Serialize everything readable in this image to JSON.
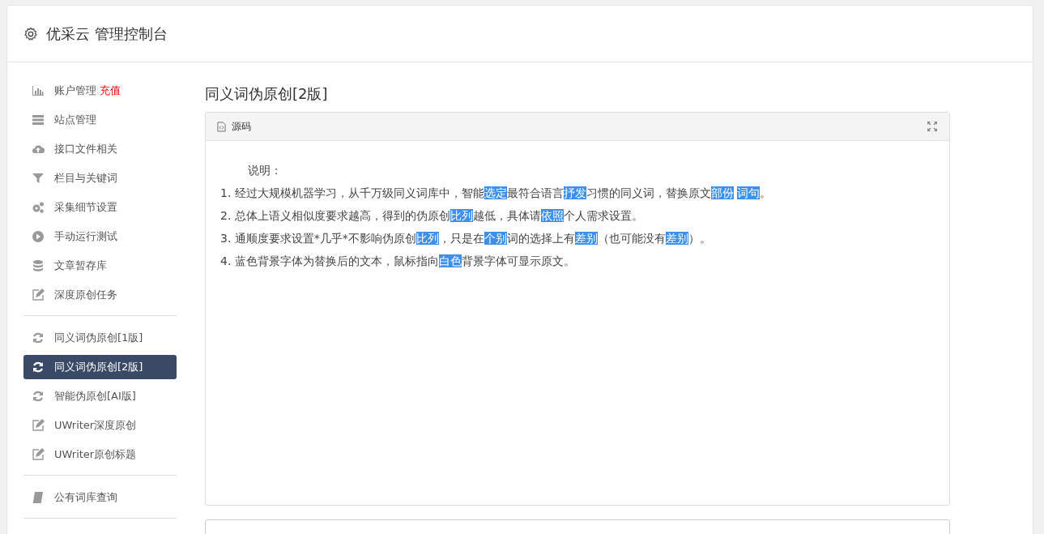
{
  "header": {
    "title": "优采云 管理控制台"
  },
  "sidebar": {
    "groups": [
      {
        "items": [
          {
            "label": "账户管理",
            "badge": "充值",
            "selected": false
          },
          {
            "label": "站点管理",
            "selected": false
          },
          {
            "label": "接口文件相关",
            "selected": false
          },
          {
            "label": "栏目与关键词",
            "selected": false
          },
          {
            "label": "采集细节设置",
            "selected": false
          },
          {
            "label": "手动运行测试",
            "selected": false
          },
          {
            "label": "文章暂存库",
            "selected": false
          },
          {
            "label": "深度原创任务",
            "selected": false
          }
        ]
      },
      {
        "items": [
          {
            "label": "同义词伪原创[1版]",
            "selected": false
          },
          {
            "label": "同义词伪原创[2版]",
            "selected": true
          },
          {
            "label": "智能伪原创[AI版]",
            "selected": false
          },
          {
            "label": "UWriter深度原创",
            "selected": false
          },
          {
            "label": "UWriter原创标题",
            "selected": false
          }
        ]
      },
      {
        "items": [
          {
            "label": "公有词库查询",
            "selected": false
          }
        ]
      }
    ]
  },
  "page_title": "同义词伪原创[2版]",
  "editor": {
    "toolbar_label": "源码",
    "heading": "说明：",
    "lines": [
      [
        {
          "text": "1. 经过大规模机器学习，从千万级同义词库中，智能",
          "highlighted": false
        },
        {
          "text": "选定",
          "highlighted": true
        },
        {
          "text": "最符合语言",
          "highlighted": false
        },
        {
          "text": "抒发",
          "highlighted": true
        },
        {
          "text": "习惯的同义词，替换原文",
          "highlighted": false
        },
        {
          "text": "部份",
          "highlighted": true
        },
        {
          "text": "词句",
          "highlighted": true
        },
        {
          "text": "。",
          "highlighted": false
        }
      ],
      [
        {
          "text": "2. 总体上语义相似度要求越高，得到的伪原创",
          "highlighted": false
        },
        {
          "text": "比列",
          "highlighted": true
        },
        {
          "text": "越低，具体请",
          "highlighted": false
        },
        {
          "text": "依照",
          "highlighted": true
        },
        {
          "text": "个人需求设置。",
          "highlighted": false
        }
      ],
      [
        {
          "text": "3. 通顺度要求设置*几乎*不影响伪原创",
          "highlighted": false
        },
        {
          "text": "比列",
          "highlighted": true
        },
        {
          "text": "，只是在",
          "highlighted": false
        },
        {
          "text": "个别",
          "highlighted": true
        },
        {
          "text": "词的选择上有",
          "highlighted": false
        },
        {
          "text": "差别",
          "highlighted": true
        },
        {
          "text": "（也可能没有",
          "highlighted": false
        },
        {
          "text": "差别",
          "highlighted": true
        },
        {
          "text": "）。",
          "highlighted": false
        }
      ],
      [
        {
          "text": "4. 蓝色背景字体为替换后的文本，鼠标指向",
          "highlighted": false
        },
        {
          "text": "白色",
          "highlighted": true
        },
        {
          "text": "背景字体可显示原文。",
          "highlighted": false
        }
      ]
    ]
  }
}
